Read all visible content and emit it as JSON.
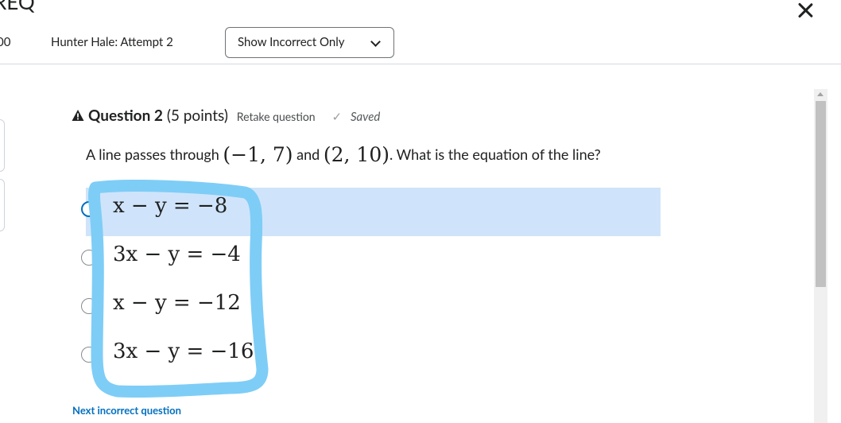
{
  "header": {
    "title_fragment": "REQ",
    "close_label": "Close",
    "score_fragment": "00",
    "attempt_label": "Hunter Hale: Attempt 2",
    "filter": {
      "selected": "Show Incorrect Only"
    }
  },
  "question": {
    "title": "Question 2",
    "points": "(5 points)",
    "retake": "Retake question",
    "status": "Saved",
    "text_prefix": "A line passes through",
    "point1": "(−1, 7)",
    "text_mid": "and",
    "point2": "(2, 10)",
    "text_suffix": ". What is the equation of the line?",
    "answers": [
      {
        "label": "x − y = −8",
        "selected": true
      },
      {
        "label": "3x − y = −4",
        "selected": false
      },
      {
        "label": "x − y = −12",
        "selected": false
      },
      {
        "label": "3x − y = −16",
        "selected": false
      }
    ]
  },
  "next_link": "Next incorrect question",
  "colors": {
    "accent": "#006fbf",
    "selected_row": "#cfe4fa",
    "annotation": "#7ecdf7"
  },
  "icons": [
    "warning-icon",
    "check-icon",
    "close-icon",
    "chevron-down-icon"
  ]
}
